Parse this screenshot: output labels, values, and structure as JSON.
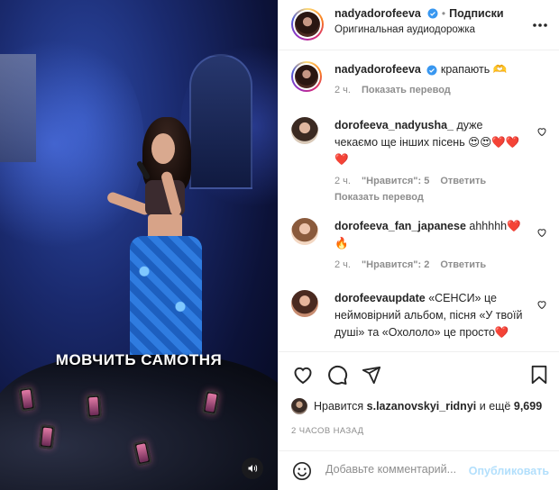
{
  "video": {
    "subtitle": "МОВЧИТЬ САМОТНЯ"
  },
  "header": {
    "username": "nadyadorofeeva",
    "separator": "•",
    "follow_label": "Подписки",
    "audio_label": "Оригинальная аудиодорожка",
    "more_icon": "more-icon"
  },
  "caption": {
    "username": "nadyadorofeeva",
    "text": "крапають 🫶",
    "time": "2 ч.",
    "translate": "Показать перевод"
  },
  "comments": [
    {
      "username": "dorofeeva_nadyusha_",
      "text": "дуже чекаємо ще інших пісень 😍😍❤️❤️❤️",
      "time": "2 ч.",
      "likes": "\"Нравится\": 5",
      "reply": "Ответить",
      "translate": "Показать перевод"
    },
    {
      "username": "dorofeeva_fan_japanese",
      "text": "ahhhhh❤️🔥",
      "time": "2 ч.",
      "likes": "\"Нравится\": 2",
      "reply": "Ответить"
    },
    {
      "username": "dorofeevaupdate",
      "text": "«СЕНСИ» це неймовірний альбом, пісня «У твоїй душі» та «Охололо» це просто❤️"
    }
  ],
  "actions": {
    "like_icon": "heart-icon",
    "comment_icon": "comment-icon",
    "share_icon": "share-icon",
    "save_icon": "bookmark-icon"
  },
  "likes": {
    "prefix": "Нравится",
    "user": "s.lazanovskyi_ridnyi",
    "suffix": "и ещё",
    "count": "9,699"
  },
  "time_ago": "2 ЧАСОВ НАЗАД",
  "composer": {
    "placeholder": "Добавьте комментарий...",
    "publish_label": "Опубликовать",
    "emoji_icon": "emoji-icon"
  },
  "colors": {
    "verified": "#3897f0",
    "link": "#0095f6",
    "publish_disabled": "#b2dffc",
    "heart_red": "#ed4956"
  }
}
